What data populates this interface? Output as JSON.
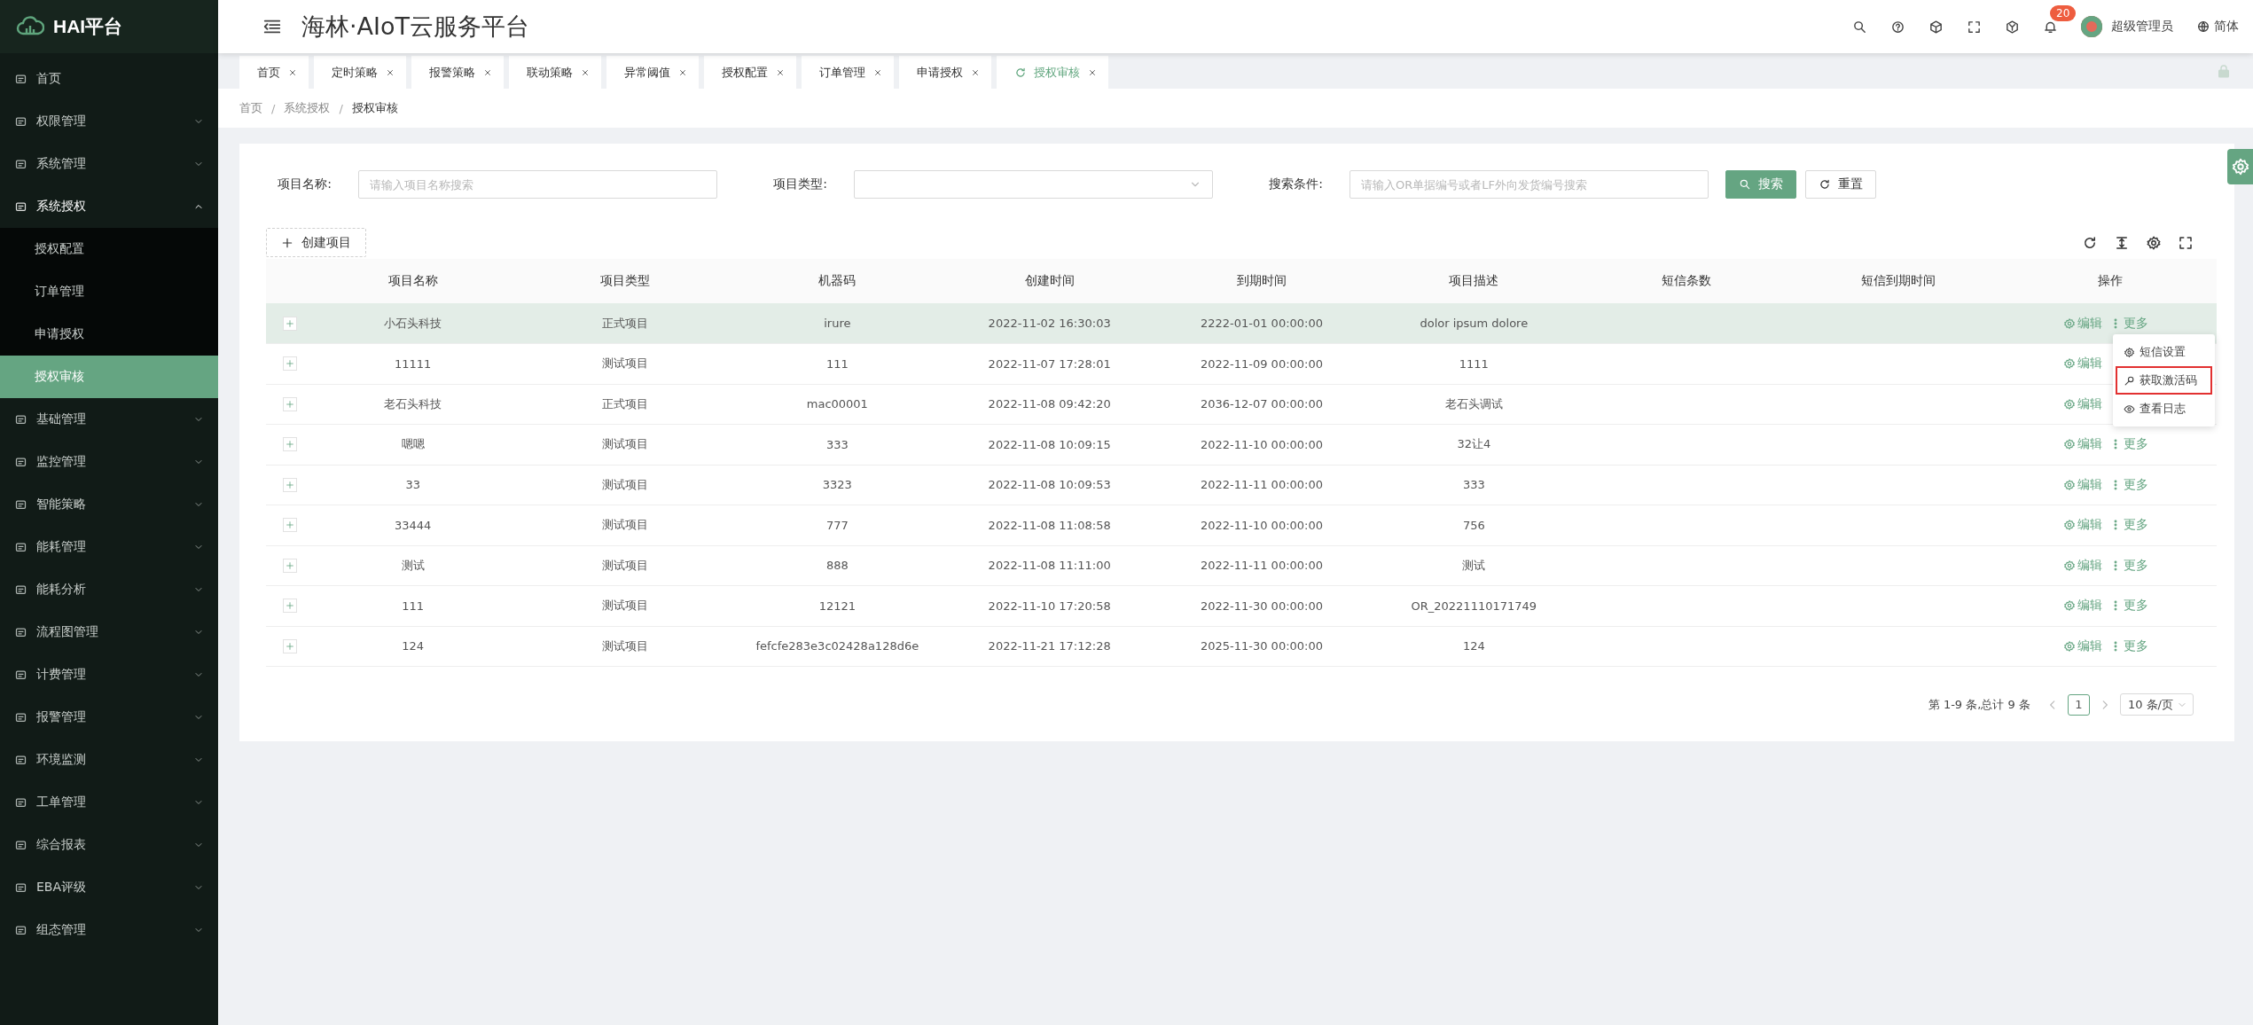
{
  "brand": {
    "name": "HAI平台"
  },
  "header": {
    "title": "海林·AIoT云服务平台",
    "notifications": "20",
    "user": "超级管理员",
    "language": "简体"
  },
  "sidebar": {
    "items": [
      {
        "label": "首页",
        "selected": false
      },
      {
        "label": "权限管理",
        "selected": false,
        "expanded": false
      },
      {
        "label": "系统管理",
        "selected": false,
        "expanded": false
      },
      {
        "label": "系统授权",
        "selected": false,
        "expanded": true,
        "children": [
          {
            "label": "授权配置",
            "selected": false
          },
          {
            "label": "订单管理",
            "selected": false
          },
          {
            "label": "申请授权",
            "selected": false
          },
          {
            "label": "授权审核",
            "selected": true
          }
        ]
      },
      {
        "label": "基础管理",
        "selected": false,
        "expanded": false
      },
      {
        "label": "监控管理",
        "selected": false,
        "expanded": false
      },
      {
        "label": "智能策略",
        "selected": false,
        "expanded": false
      },
      {
        "label": "能耗管理",
        "selected": false,
        "expanded": false
      },
      {
        "label": "能耗分析",
        "selected": false,
        "expanded": false
      },
      {
        "label": "流程图管理",
        "selected": false,
        "expanded": false
      },
      {
        "label": "计费管理",
        "selected": false,
        "expanded": false
      },
      {
        "label": "报警管理",
        "selected": false,
        "expanded": false
      },
      {
        "label": "环境监测",
        "selected": false,
        "expanded": false
      },
      {
        "label": "工单管理",
        "selected": false,
        "expanded": false
      },
      {
        "label": "综合报表",
        "selected": false,
        "expanded": false
      },
      {
        "label": "EBA评级",
        "selected": false,
        "expanded": false
      },
      {
        "label": "组态管理",
        "selected": false,
        "expanded": false
      }
    ]
  },
  "tabs": [
    {
      "label": "首页",
      "selected": false
    },
    {
      "label": "定时策略",
      "selected": false
    },
    {
      "label": "报警策略",
      "selected": false
    },
    {
      "label": "联动策略",
      "selected": false
    },
    {
      "label": "异常阈值",
      "selected": false
    },
    {
      "label": "授权配置",
      "selected": false
    },
    {
      "label": "订单管理",
      "selected": false
    },
    {
      "label": "申请授权",
      "selected": false
    },
    {
      "label": "授权审核",
      "selected": true
    }
  ],
  "breadcrumb": {
    "items": [
      "首页",
      "系统授权",
      "授权审核"
    ],
    "separators": [
      "/",
      "/"
    ]
  },
  "filters": [
    {
      "kind": "text",
      "label": "项目名称:",
      "placeholder": "请输入项目名称搜索"
    },
    {
      "kind": "select",
      "label": "项目类型:"
    },
    {
      "kind": "text",
      "label": "搜索条件:",
      "placeholder": "请输入OR单据编号或者LF外向发货编号搜索"
    }
  ],
  "buttons": {
    "search": "搜索",
    "reset": "重置",
    "create": "创建项目"
  },
  "table": {
    "columns": [
      "项目名称",
      "项目类型",
      "机器码",
      "创建时间",
      "到期时间",
      "项目描述",
      "短信条数",
      "短信到期时间",
      "操作"
    ],
    "rows": [
      {
        "highlighted": true,
        "expanded": false,
        "cells": [
          "小石头科技",
          "正式项目",
          "irure",
          "2022-11-02 16:30:03",
          "2222-01-01 00:00:00",
          "dolor ipsum dolore"
        ],
        "actions": [
          "编辑",
          "更多"
        ]
      },
      {
        "highlighted": false,
        "expanded": false,
        "cells": [
          "11111",
          "测试项目",
          "111",
          "2022-11-07 17:28:01",
          "2022-11-09 00:00:00",
          "1111"
        ],
        "actions": [
          "编辑"
        ]
      },
      {
        "highlighted": false,
        "expanded": false,
        "cells": [
          "老石头科技",
          "正式项目",
          "mac00001",
          "2022-11-08 09:42:20",
          "2036-12-07 00:00:00",
          "老石头调试"
        ],
        "actions": [
          "编辑"
        ]
      },
      {
        "highlighted": false,
        "expanded": false,
        "cells": [
          "嗯嗯",
          "测试项目",
          "333",
          "2022-11-08 10:09:15",
          "2022-11-10 00:00:00",
          "32让4"
        ],
        "actions": [
          "编辑",
          "更多"
        ]
      },
      {
        "highlighted": false,
        "expanded": false,
        "cells": [
          "33",
          "测试项目",
          "3323",
          "2022-11-08 10:09:53",
          "2022-11-11 00:00:00",
          "333"
        ],
        "actions": [
          "编辑",
          "更多"
        ]
      },
      {
        "highlighted": false,
        "expanded": false,
        "cells": [
          "33444",
          "测试项目",
          "777",
          "2022-11-08 11:08:58",
          "2022-11-10 00:00:00",
          "756"
        ],
        "actions": [
          "编辑",
          "更多"
        ]
      },
      {
        "highlighted": false,
        "expanded": false,
        "cells": [
          "测试",
          "测试项目",
          "888",
          "2022-11-08 11:11:00",
          "2022-11-11 00:00:00",
          "测试"
        ],
        "actions": [
          "编辑",
          "更多"
        ]
      },
      {
        "highlighted": false,
        "expanded": false,
        "cells": [
          "111",
          "测试项目",
          "12121",
          "2022-11-10 17:20:58",
          "2022-11-30 00:00:00",
          "OR_20221110171749"
        ],
        "actions": [
          "编辑",
          "更多"
        ]
      },
      {
        "highlighted": false,
        "expanded": false,
        "cells": [
          "124",
          "测试项目",
          "fefcfe283e3c02428a128d6e",
          "2022-11-21 17:12:28",
          "2025-11-30 00:00:00",
          "124"
        ],
        "actions": [
          "编辑",
          "更多"
        ]
      }
    ]
  },
  "dropdown": {
    "items": [
      {
        "kind": "settings",
        "label": "短信设置",
        "outlined": false
      },
      {
        "kind": "activation",
        "label": "获取激活码",
        "outlined": true
      },
      {
        "kind": "log",
        "label": "查看日志",
        "outlined": false
      }
    ]
  },
  "pagination": {
    "summary": "第 1-9 条,总计 9 条",
    "pages": [
      {
        "label": "1",
        "selected": true
      }
    ],
    "page_size": "10 条/页"
  }
}
